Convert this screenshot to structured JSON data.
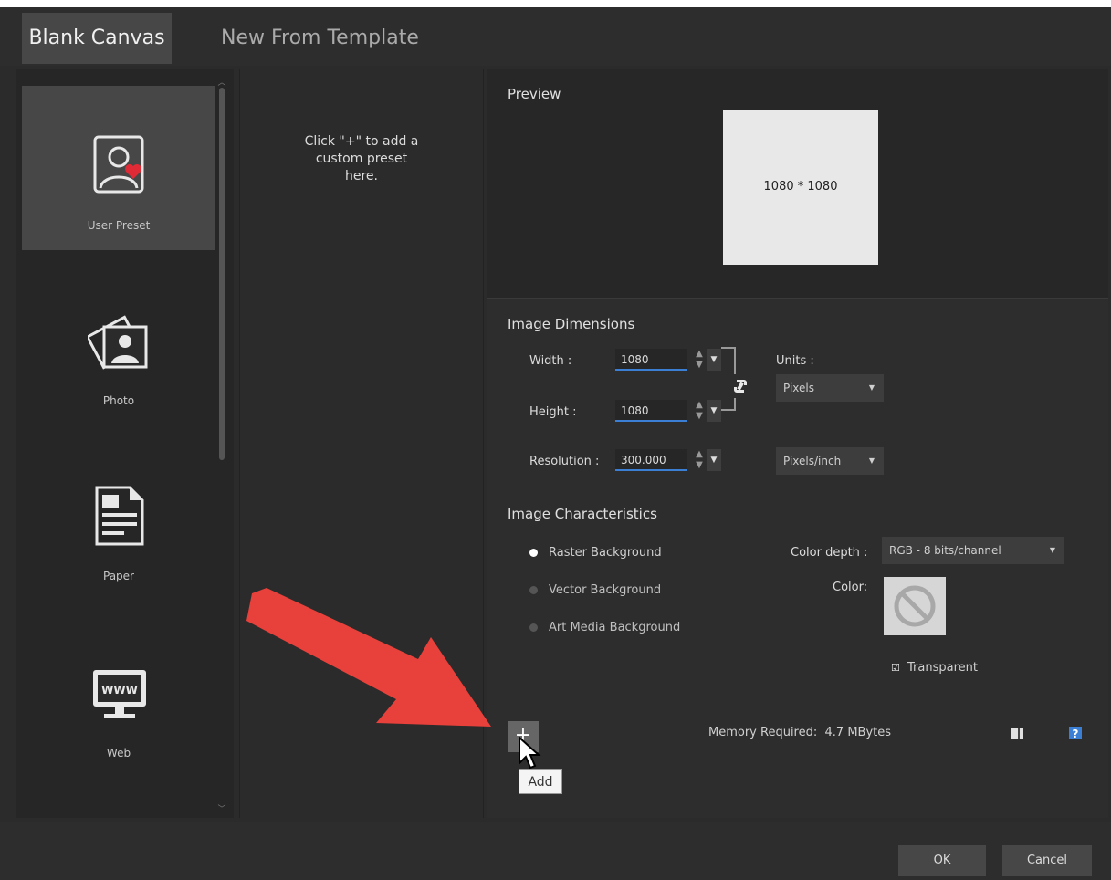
{
  "tabs": {
    "blank_canvas": "Blank Canvas",
    "new_from_template": "New From Template"
  },
  "categories": [
    {
      "label": "User Preset",
      "icon": "user-preset-icon",
      "selected": true
    },
    {
      "label": "Photo",
      "icon": "photo-icon",
      "selected": false
    },
    {
      "label": "Paper",
      "icon": "paper-icon",
      "selected": false
    },
    {
      "label": "Web",
      "icon": "web-icon",
      "selected": false
    }
  ],
  "preset_hint": "Click \"+\" to add a custom preset here.",
  "preview": {
    "title": "Preview",
    "size_label": "1080 * 1080"
  },
  "dimensions": {
    "title": "Image Dimensions",
    "width_label": "Width :",
    "width_value": "1080",
    "height_label": "Height :",
    "height_value": "1080",
    "resolution_label": "Resolution :",
    "resolution_value": "300.000",
    "units_label": "Units :",
    "units_value": "Pixels",
    "resolution_units_value": "Pixels/inch"
  },
  "characteristics": {
    "title": "Image Characteristics",
    "raster_label": "Raster Background",
    "vector_label": "Vector Background",
    "artmedia_label": "Art Media Background",
    "color_depth_label": "Color depth :",
    "color_depth_value": "RGB - 8 bits/channel",
    "color_label": "Color:",
    "transparent_label": "Transparent",
    "transparent_checked": true
  },
  "add_tooltip": "Add",
  "memory": {
    "label": "Memory Required:",
    "value": "4.7 MBytes"
  },
  "buttons": {
    "ok": "OK",
    "cancel": "Cancel"
  },
  "colors": {
    "accent": "#3b7fd4",
    "arrow": "#e8403a",
    "heart": "#e02a35"
  }
}
